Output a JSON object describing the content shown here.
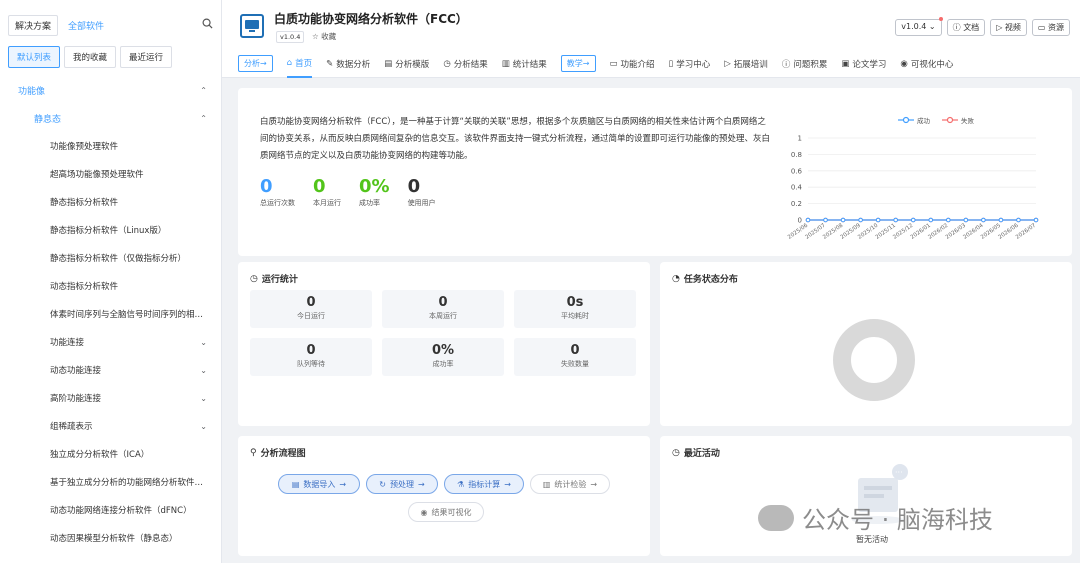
{
  "sidebar": {
    "tabs": [
      "解决方案",
      "全部软件"
    ],
    "subtabs": [
      "默认列表",
      "我的收藏",
      "最近运行"
    ],
    "group": "功能像",
    "subgroup": "静息态",
    "items": [
      {
        "label": "功能像预处理软件",
        "chev": ""
      },
      {
        "label": "超高场功能像预处理软件",
        "chev": ""
      },
      {
        "label": "静态指标分析软件",
        "chev": ""
      },
      {
        "label": "静态指标分析软件（Linux版）",
        "chev": ""
      },
      {
        "label": "静态指标分析软件（仅做指标分析）",
        "chev": ""
      },
      {
        "label": "动态指标分析软件",
        "chev": ""
      },
      {
        "label": "体素时间序列与全脑信号时间序列的相…",
        "chev": ""
      },
      {
        "label": "功能连接",
        "chev": "⌄"
      },
      {
        "label": "动态功能连接",
        "chev": "⌄"
      },
      {
        "label": "高阶功能连接",
        "chev": "⌄"
      },
      {
        "label": "组稀疏表示",
        "chev": "⌄"
      },
      {
        "label": "独立成分分析软件（ICA）",
        "chev": ""
      },
      {
        "label": "基于独立成分分析的功能网络分析软件…",
        "chev": ""
      },
      {
        "label": "动态功能网络连接分析软件（dFNC）",
        "chev": ""
      },
      {
        "label": "动态因果模型分析软件（静息态）",
        "chev": ""
      }
    ]
  },
  "header": {
    "title": "白质功能协变网络分析软件（FCC）",
    "version_tag": "v1.0.4",
    "fav": "☆ 收藏",
    "version_select": "v1.0.4",
    "buttons": [
      "文档",
      "视频",
      "资源"
    ]
  },
  "nav": {
    "pill1": "分析→",
    "tabs1": [
      "首页",
      "数据分析",
      "分析模版",
      "分析结果",
      "统计结果"
    ],
    "pill2": "教学→",
    "tabs2": [
      "功能介绍",
      "学习中心",
      "拓展培训",
      "问题积累",
      "论文学习",
      "可视化中心"
    ]
  },
  "intro": {
    "text": "白质功能协变网络分析软件（FCC），是一种基于计算“关联的关联”思想，根据多个灰质脑区与白质网络的相关性来估计两个白质网络之间的协变关系，从而反映白质网络间复杂的信息交互。该软件界面支持一键式分析流程，通过简单的设置即可运行功能像的预处理、灰白质网络节点的定义以及白质功能协变网络的构建等功能。",
    "stats": [
      {
        "value": "0",
        "label": "总运行次数",
        "color": "#409eff"
      },
      {
        "value": "0",
        "label": "本月运行",
        "color": "#52c41a"
      },
      {
        "value": "0%",
        "label": "成功率",
        "color": "#52c41a"
      },
      {
        "value": "0",
        "label": "使用用户",
        "color": "#333333"
      }
    ]
  },
  "chart_data": {
    "type": "line",
    "x": [
      "2025/06",
      "2025/07",
      "2025/08",
      "2025/09",
      "2025/10",
      "2025/11",
      "2025/12",
      "2026/01",
      "2026/02",
      "2026/03",
      "2026/04",
      "2026/05",
      "2026/06",
      "2026/07"
    ],
    "series": [
      {
        "name": "成功",
        "color": "#409eff",
        "values": [
          0,
          0,
          0,
          0,
          0,
          0,
          0,
          0,
          0,
          0,
          0,
          0,
          0,
          0
        ]
      },
      {
        "name": "失败",
        "color": "#f56c6c",
        "values": [
          0,
          0,
          0,
          0,
          0,
          0,
          0,
          0,
          0,
          0,
          0,
          0,
          0,
          0
        ]
      }
    ],
    "yticks": [
      "0",
      "0.2",
      "0.4",
      "0.6",
      "0.8",
      "1"
    ],
    "ylim": [
      0,
      1
    ],
    "legend": "top-right"
  },
  "run_stats": {
    "title": "运行统计",
    "cells": [
      {
        "value": "0",
        "label": "今日运行"
      },
      {
        "value": "0",
        "label": "本周运行"
      },
      {
        "value": "0s",
        "label": "平均耗时"
      },
      {
        "value": "0",
        "label": "队列等待"
      },
      {
        "value": "0%",
        "label": "成功率"
      },
      {
        "value": "0",
        "label": "失败数量"
      }
    ]
  },
  "dist": {
    "title": "任务状态分布"
  },
  "flow": {
    "title": "分析流程图",
    "steps": [
      "数据导入",
      "预处理",
      "指标计算",
      "统计检验",
      "结果可视化"
    ]
  },
  "recent": {
    "title": "最近活动",
    "empty": "暂无活动"
  },
  "watermark": "公众号 · 脑海科技"
}
